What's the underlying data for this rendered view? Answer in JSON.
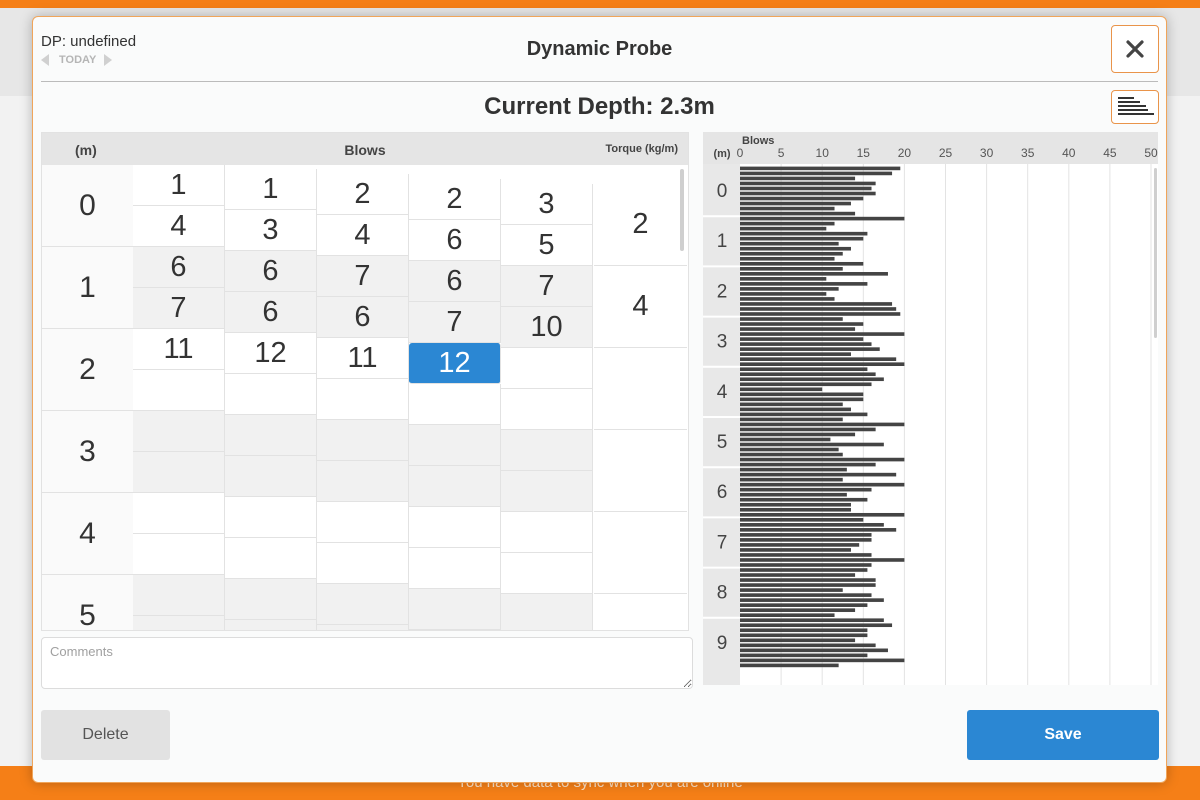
{
  "app": {
    "sync_message": "You have data to sync when you are online"
  },
  "modal": {
    "dp_label": "DP: undefined",
    "today_label": "TODAY",
    "title": "Dynamic Probe",
    "current_depth": "Current Depth: 2.3m"
  },
  "grid": {
    "header_m": "(m)",
    "header_blows": "Blows",
    "header_torque": "Torque (kg/m)",
    "depths": [
      "0",
      "1",
      "2",
      "3",
      "4",
      "5"
    ],
    "blows_columns": [
      [
        "1",
        "4",
        "6",
        "7",
        "11",
        "",
        "",
        "",
        "",
        "",
        "",
        ""
      ],
      [
        "1",
        "3",
        "6",
        "6",
        "12",
        "",
        "",
        "",
        "",
        "",
        "",
        ""
      ],
      [
        "2",
        "4",
        "7",
        "6",
        "11",
        "",
        "",
        "",
        "",
        "",
        "",
        ""
      ],
      [
        "2",
        "6",
        "6",
        "7",
        "12",
        "",
        "",
        "",
        "",
        "",
        "",
        ""
      ],
      [
        "3",
        "5",
        "7",
        "10",
        "",
        "",
        "",
        "",
        "",
        "",
        "",
        ""
      ]
    ],
    "selected": {
      "column": 3,
      "row": 4
    },
    "torque": [
      "2",
      "4",
      "",
      "",
      "",
      ""
    ],
    "comments_placeholder": "Comments"
  },
  "chart_data": {
    "type": "bar",
    "orientation": "horizontal",
    "title": "",
    "x_axis_label": "Blows",
    "y_axis_label": "(m)",
    "x_ticks": [
      0,
      5,
      10,
      15,
      20,
      25,
      30,
      35,
      40,
      45,
      50
    ],
    "y_ticks": [
      "0",
      "1",
      "2",
      "3",
      "4",
      "5",
      "6",
      "7",
      "8",
      "9"
    ],
    "xlim": [
      0,
      50
    ],
    "grid": true,
    "color": "#444444",
    "step_m": 0.1,
    "values": [
      19.5,
      18.5,
      14,
      16.5,
      16,
      16.5,
      15,
      13.5,
      11.5,
      14,
      20,
      11.5,
      10.5,
      15.5,
      15,
      12,
      13.5,
      12.5,
      11.5,
      15,
      12.5,
      18,
      10.5,
      15.5,
      12,
      10.5,
      11.5,
      18.5,
      19,
      19.5,
      12.5,
      15,
      14,
      20,
      15,
      16,
      17,
      13.5,
      19,
      20,
      15.5,
      16.5,
      17.5,
      16,
      10,
      15,
      15,
      12.5,
      13.5,
      15.5,
      12.5,
      20,
      16.5,
      14,
      11,
      17.5,
      12,
      12.5,
      20,
      16.5,
      13,
      19,
      12.5,
      20,
      16,
      13,
      15.5,
      13.5,
      13.5,
      20,
      15,
      17.5,
      19,
      16,
      16,
      14.5,
      13.5,
      16,
      20,
      16,
      15.5,
      14,
      16.5,
      16.5,
      12.5,
      16,
      17.5,
      15.5,
      14,
      11.5,
      17.5,
      18.5,
      15.5,
      15.5,
      14,
      16.5,
      18,
      15.5,
      20,
      12
    ]
  },
  "buttons": {
    "delete": "Delete",
    "save": "Save"
  },
  "icons": {
    "close": "close-icon",
    "chart_toggle": "bar-chart-icon"
  },
  "colors": {
    "accent": "#f57f17",
    "primary": "#2b87d3",
    "bar": "#444444"
  }
}
